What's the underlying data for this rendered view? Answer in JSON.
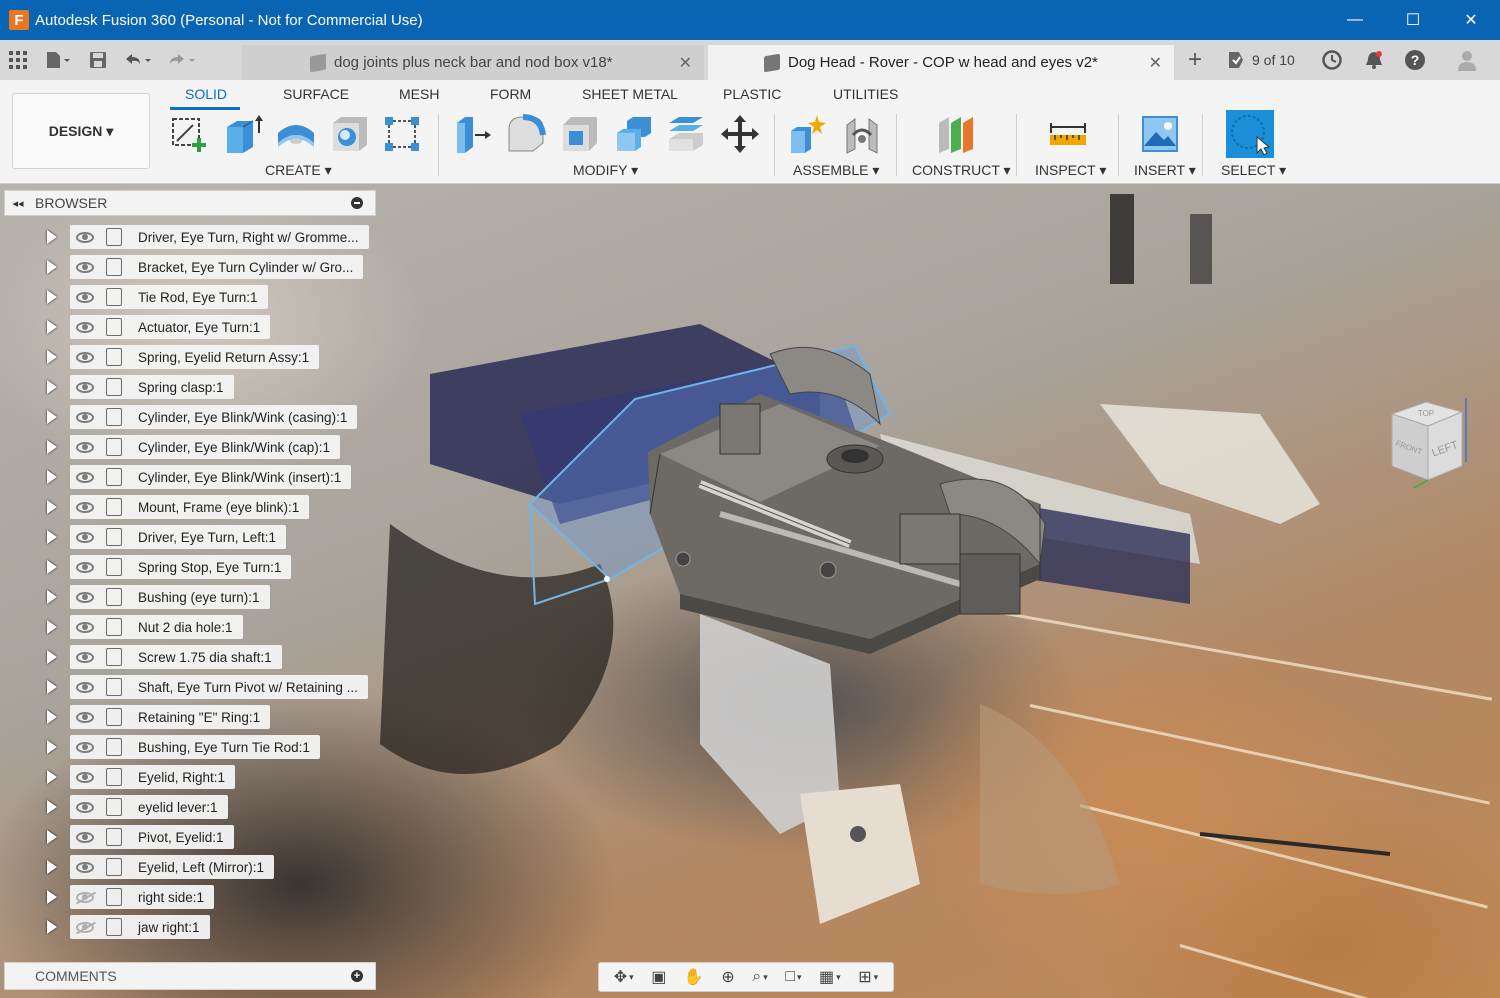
{
  "window": {
    "title": "Autodesk Fusion 360 (Personal - Not for Commercial Use)",
    "app_icon_letter": "F",
    "minimize_glyph": "—",
    "maximize_glyph": "☐",
    "close_glyph": "✕"
  },
  "tabs": [
    {
      "label": "dog joints plus neck bar and nod box v18*",
      "active": false
    },
    {
      "label": "Dog Head - Rover - COP w head and eyes v2*",
      "active": true
    }
  ],
  "tabbar": {
    "new_tab_glyph": "+",
    "job_status": "9 of 10",
    "close_glyph": "✕"
  },
  "toolbar": {
    "workspace": "DESIGN ▾",
    "ribbon_tabs": [
      "SOLID",
      "SURFACE",
      "MESH",
      "FORM",
      "SHEET METAL",
      "PLASTIC",
      "UTILITIES"
    ],
    "active_tab": "SOLID",
    "groups": {
      "create": "CREATE ▾",
      "modify": "MODIFY ▾",
      "assemble": "ASSEMBLE ▾",
      "construct": "CONSTRUCT ▾",
      "inspect": "INSPECT ▾",
      "insert": "INSERT ▾",
      "select": "SELECT ▾"
    }
  },
  "browser": {
    "title": "BROWSER",
    "collapse_glyph": "◂◂",
    "items": [
      {
        "label": "Driver, Eye Turn, Right w/ Gromme...",
        "visible": true
      },
      {
        "label": "Bracket, Eye Turn Cylinder w/ Gro...",
        "visible": true
      },
      {
        "label": "Tie Rod, Eye Turn:1",
        "visible": true
      },
      {
        "label": "Actuator, Eye Turn:1",
        "visible": true
      },
      {
        "label": "Spring, Eyelid Return Assy:1",
        "visible": true
      },
      {
        "label": "Spring clasp:1",
        "visible": true
      },
      {
        "label": "Cylinder, Eye Blink/Wink (casing):1",
        "visible": true
      },
      {
        "label": "Cylinder, Eye Blink/Wink (cap):1",
        "visible": true
      },
      {
        "label": "Cylinder, Eye Blink/Wink (insert):1",
        "visible": true
      },
      {
        "label": "Mount, Frame (eye blink):1",
        "visible": true
      },
      {
        "label": "Driver, Eye Turn, Left:1",
        "visible": true
      },
      {
        "label": "Spring Stop, Eye Turn:1",
        "visible": true
      },
      {
        "label": "Bushing (eye turn):1",
        "visible": true
      },
      {
        "label": "Nut 2 dia hole:1",
        "visible": true
      },
      {
        "label": "Screw 1.75 dia shaft:1",
        "visible": true
      },
      {
        "label": "Shaft, Eye Turn Pivot w/ Retaining ...",
        "visible": true
      },
      {
        "label": "Retaining \"E\" Ring:1",
        "visible": true
      },
      {
        "label": "Bushing, Eye Turn Tie Rod:1",
        "visible": true
      },
      {
        "label": "Eyelid, Right:1",
        "visible": true
      },
      {
        "label": "eyelid lever:1",
        "visible": true
      },
      {
        "label": "Pivot, Eyelid:1",
        "visible": true
      },
      {
        "label": "Eyelid, Left (Mirror):1",
        "visible": true
      },
      {
        "label": "right side:1",
        "visible": false
      },
      {
        "label": "jaw right:1",
        "visible": false
      }
    ]
  },
  "comments": {
    "title": "COMMENTS",
    "add_glyph": "+"
  },
  "viewcube": {
    "face_label": "LEFT",
    "top_label": "TOP",
    "front_label": "FRONT"
  },
  "navbar": {
    "orbit_glyph": "✥",
    "look_at_glyph": "▣",
    "pan_glyph": "✋",
    "zoom_glyph": "⊕",
    "fit_glyph": "⌕",
    "display_glyph": "□",
    "grid_glyph": "▦",
    "viewports_glyph": "⊞",
    "caret_glyph": "▾"
  },
  "colors": {
    "titlebar": "#0a64b4",
    "accent": "#0b6fc4",
    "select_tool": "#1a8fd8"
  }
}
